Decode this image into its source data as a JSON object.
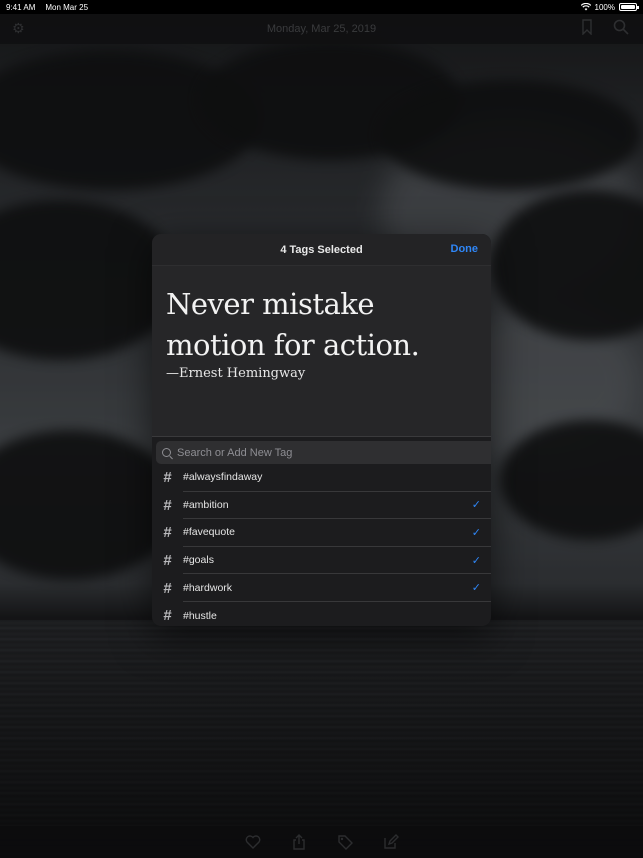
{
  "status_bar": {
    "time": "9:41 AM",
    "date": "Mon Mar 25",
    "battery": "100%",
    "battery_level": 1.0
  },
  "navbar": {
    "title": "Monday, Mar 25, 2019",
    "left_icon": "gear-icon",
    "right_icons": [
      "bookmark-icon",
      "search-icon"
    ]
  },
  "toolbar": {
    "icons": [
      "heart-icon",
      "share-icon",
      "tag-icon",
      "edit-icon"
    ]
  },
  "modal": {
    "title": "4 Tags Selected",
    "done_label": "Done",
    "quote": {
      "line1": "Never mistake",
      "line2": "motion for action.",
      "author": "—Ernest Hemingway"
    },
    "search": {
      "placeholder": "Search or Add New Tag",
      "value": ""
    },
    "tags": [
      {
        "label": "#alwaysfindaway",
        "selected": false
      },
      {
        "label": "#ambition",
        "selected": true
      },
      {
        "label": "#favequote",
        "selected": true
      },
      {
        "label": "#goals",
        "selected": true
      },
      {
        "label": "#hardwork",
        "selected": true
      },
      {
        "label": "#hustle",
        "selected": false
      }
    ]
  },
  "colors": {
    "accent": "#2f86f6",
    "modal_bg": "#1c1c1e",
    "quote_card_bg": "#262628"
  }
}
